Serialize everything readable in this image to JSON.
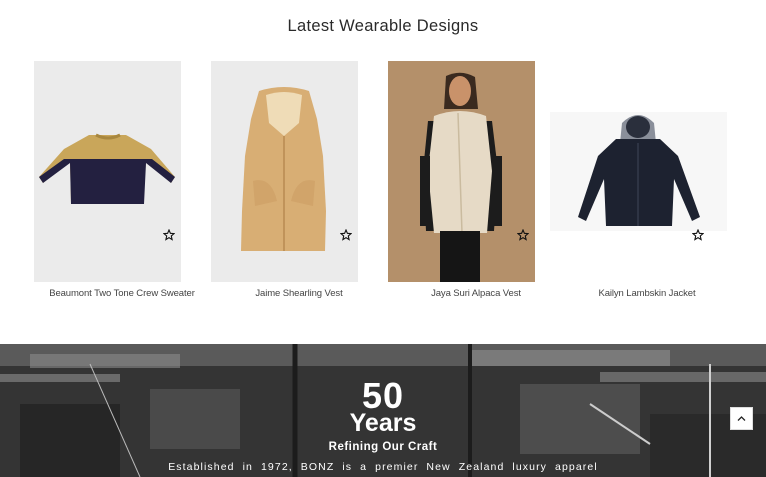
{
  "section": {
    "title": "Latest Wearable Designs"
  },
  "products": [
    {
      "name": "Beaumont Two Tone Crew Sweater",
      "wishlist_icon": "star-outline-icon"
    },
    {
      "name": "Jaime Shearling Vest",
      "wishlist_icon": "star-outline-icon"
    },
    {
      "name": "Jaya Suri Alpaca Vest",
      "wishlist_icon": "star-outline-icon"
    },
    {
      "name": "Kailyn Lambskin Jacket",
      "wishlist_icon": "star-outline-icon"
    }
  ],
  "banner": {
    "number": "50",
    "unit": "Years",
    "tagline": "Refining Our Craft",
    "text": "Established in 1972, BONZ is a premier New Zealand luxury apparel"
  },
  "back_to_top": {
    "icon": "chevron-up-icon"
  }
}
